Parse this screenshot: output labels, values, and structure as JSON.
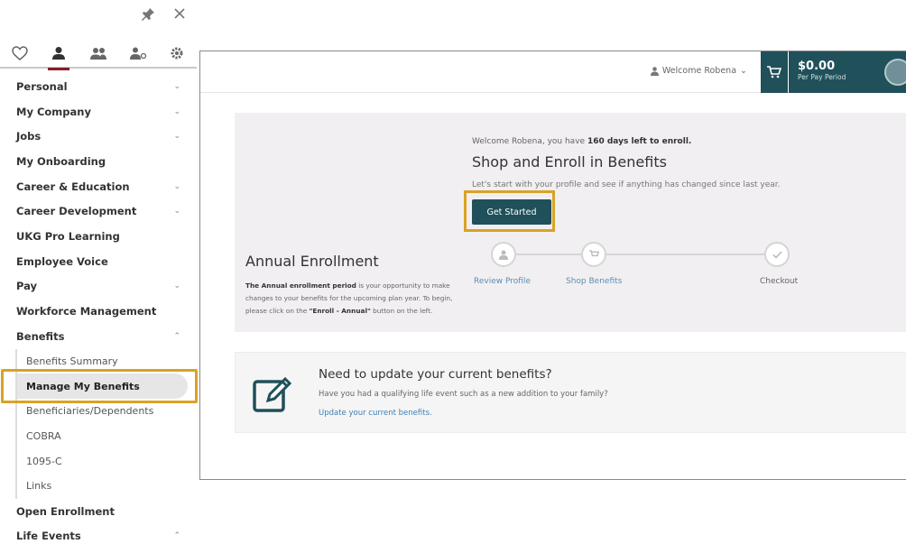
{
  "nav": {
    "items": [
      {
        "label": "Personal",
        "chevron": "down"
      },
      {
        "label": "My Company",
        "chevron": "down"
      },
      {
        "label": "Jobs",
        "chevron": "down"
      },
      {
        "label": "My Onboarding",
        "chevron": ""
      },
      {
        "label": "Career & Education",
        "chevron": "down"
      },
      {
        "label": "Career Development",
        "chevron": "down"
      },
      {
        "label": "UKG Pro Learning",
        "chevron": ""
      },
      {
        "label": "Employee Voice",
        "chevron": ""
      },
      {
        "label": "Pay",
        "chevron": "down"
      },
      {
        "label": "Workforce Management",
        "chevron": ""
      },
      {
        "label": "Benefits",
        "chevron": "up"
      }
    ],
    "benefits_sub": [
      "Benefits Summary",
      "Manage My Benefits",
      "Beneficiaries/Dependents",
      "COBRA",
      "1095-C",
      "Links"
    ],
    "after_items": [
      {
        "label": "Open Enrollment",
        "chevron": ""
      },
      {
        "label": "Life Events",
        "chevron": "up"
      }
    ],
    "highlight_color": "#d9a227",
    "active_tab_color": "#8a1c2b"
  },
  "header": {
    "welcome": "Welcome Robena",
    "cart_amount": "$0.00",
    "cart_sub": "Per Pay Period",
    "brand_color": "#20505a"
  },
  "enroll": {
    "welcome_pre": "Welcome Robena, you have",
    "days_left": "160 days left to enroll.",
    "title": "Shop and Enroll in Benefits",
    "desc": "Let's start with your profile and see if anything has changed since last year.",
    "button": "Get Started",
    "annual_title": "Annual Enrollment",
    "annual_bold": "The Annual enrollment period",
    "annual_rest": "is your opportunity to make changes to your benefits for the upcoming plan year. To begin, please click on the",
    "annual_btn": "\"Enroll - Annual\"",
    "annual_end": "button on the left.",
    "steps": [
      "Review Profile",
      "Shop Benefits",
      "Checkout"
    ]
  },
  "update": {
    "title": "Need to update your current benefits?",
    "desc": "Have you had a qualifying life event such as a new addition to your family?",
    "link": "Update your current benefits."
  }
}
